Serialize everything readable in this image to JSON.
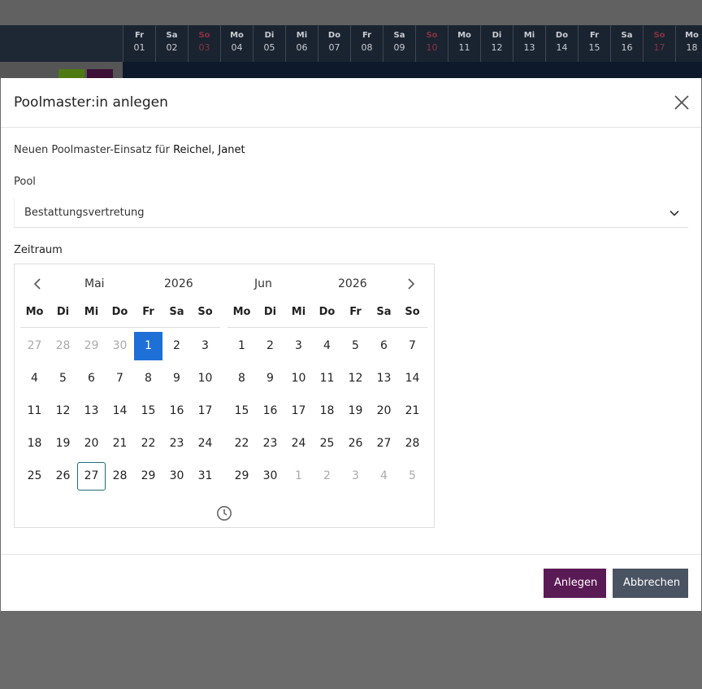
{
  "background": {
    "days": [
      {
        "dn": "Fr",
        "dd": "01",
        "sun": false
      },
      {
        "dn": "Sa",
        "dd": "02",
        "sun": false
      },
      {
        "dn": "So",
        "dd": "03",
        "sun": true
      },
      {
        "dn": "Mo",
        "dd": "04",
        "sun": false
      },
      {
        "dn": "Di",
        "dd": "05",
        "sun": false
      },
      {
        "dn": "Mi",
        "dd": "06",
        "sun": false
      },
      {
        "dn": "Do",
        "dd": "07",
        "sun": false
      },
      {
        "dn": "Fr",
        "dd": "08",
        "sun": false
      },
      {
        "dn": "Sa",
        "dd": "09",
        "sun": false
      },
      {
        "dn": "So",
        "dd": "10",
        "sun": true
      },
      {
        "dn": "Mo",
        "dd": "11",
        "sun": false
      },
      {
        "dn": "Di",
        "dd": "12",
        "sun": false
      },
      {
        "dn": "Mi",
        "dd": "13",
        "sun": false
      },
      {
        "dn": "Do",
        "dd": "14",
        "sun": false
      },
      {
        "dn": "Fr",
        "dd": "15",
        "sun": false
      },
      {
        "dn": "Sa",
        "dd": "16",
        "sun": false
      },
      {
        "dn": "So",
        "dd": "17",
        "sun": true
      },
      {
        "dn": "Mo",
        "dd": "18",
        "sun": false
      }
    ]
  },
  "modal": {
    "title": "Poolmaster:in anlegen",
    "close_icon": "close-icon",
    "intro_prefix": "Neuen Poolmaster-Einsatz für ",
    "intro_name": "Reichel, Janet",
    "pool_label": "Pool",
    "pool_value": "Bestattungsvertretung",
    "zeitraum_label": "Zeitraum",
    "create_label": "Anlegen",
    "cancel_label": "Abbrechen"
  },
  "calendar": {
    "weekdays": [
      "Mo",
      "Di",
      "Mi",
      "Do",
      "Fr",
      "Sa",
      "So"
    ],
    "months": [
      {
        "name": "Mai",
        "year": "2026",
        "weeks": [
          [
            {
              "d": "27",
              "m": true
            },
            {
              "d": "28",
              "m": true
            },
            {
              "d": "29",
              "m": true
            },
            {
              "d": "30",
              "m": true
            },
            {
              "d": "1",
              "sel": true
            },
            {
              "d": "2"
            },
            {
              "d": "3"
            }
          ],
          [
            {
              "d": "4"
            },
            {
              "d": "5"
            },
            {
              "d": "6"
            },
            {
              "d": "7"
            },
            {
              "d": "8"
            },
            {
              "d": "9"
            },
            {
              "d": "10"
            }
          ],
          [
            {
              "d": "11"
            },
            {
              "d": "12"
            },
            {
              "d": "13"
            },
            {
              "d": "14"
            },
            {
              "d": "15"
            },
            {
              "d": "16"
            },
            {
              "d": "17"
            }
          ],
          [
            {
              "d": "18"
            },
            {
              "d": "19"
            },
            {
              "d": "20"
            },
            {
              "d": "21"
            },
            {
              "d": "22"
            },
            {
              "d": "23"
            },
            {
              "d": "24"
            }
          ],
          [
            {
              "d": "25"
            },
            {
              "d": "26"
            },
            {
              "d": "27",
              "today": true
            },
            {
              "d": "28"
            },
            {
              "d": "29"
            },
            {
              "d": "30"
            },
            {
              "d": "31"
            }
          ]
        ]
      },
      {
        "name": "Jun",
        "year": "2026",
        "weeks": [
          [
            {
              "d": "1"
            },
            {
              "d": "2"
            },
            {
              "d": "3"
            },
            {
              "d": "4"
            },
            {
              "d": "5"
            },
            {
              "d": "6"
            },
            {
              "d": "7"
            }
          ],
          [
            {
              "d": "8"
            },
            {
              "d": "9"
            },
            {
              "d": "10"
            },
            {
              "d": "11"
            },
            {
              "d": "12"
            },
            {
              "d": "13"
            },
            {
              "d": "14"
            }
          ],
          [
            {
              "d": "15"
            },
            {
              "d": "16"
            },
            {
              "d": "17"
            },
            {
              "d": "18"
            },
            {
              "d": "19"
            },
            {
              "d": "20"
            },
            {
              "d": "21"
            }
          ],
          [
            {
              "d": "22"
            },
            {
              "d": "23"
            },
            {
              "d": "24"
            },
            {
              "d": "25"
            },
            {
              "d": "26"
            },
            {
              "d": "27"
            },
            {
              "d": "28"
            }
          ],
          [
            {
              "d": "29"
            },
            {
              "d": "30"
            },
            {
              "d": "1",
              "m": true
            },
            {
              "d": "2",
              "m": true
            },
            {
              "d": "3",
              "m": true
            },
            {
              "d": "4",
              "m": true
            },
            {
              "d": "5",
              "m": true
            }
          ]
        ]
      }
    ],
    "selected_color": "#1e6fd6",
    "today_border_color": "#1b6e7a"
  },
  "colors": {
    "create_button": "#5a1a55",
    "cancel_button": "#4a5361"
  }
}
